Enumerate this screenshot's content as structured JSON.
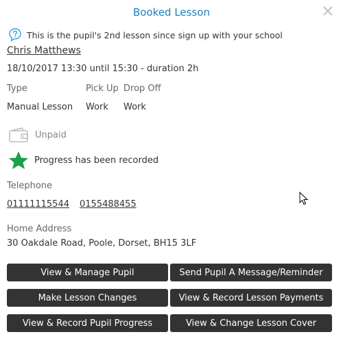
{
  "modal": {
    "title": "Booked Lesson"
  },
  "info": {
    "text": "This is the pupil's 2nd lesson since sign up with your school",
    "icon": "question-bubble-icon"
  },
  "pupil": {
    "name": "Chris Matthews"
  },
  "lesson": {
    "datetime": "18/10/2017 13:30 until 15:30 - duration 2h",
    "type_label": "Type",
    "type_value": "Manual Lesson",
    "pickup_label": "Pick Up",
    "pickup_value": "Work",
    "dropoff_label": "Drop Off",
    "dropoff_value": "Work"
  },
  "payment": {
    "status": "Unpaid",
    "icon": "wallet-icon"
  },
  "progress": {
    "text": "Progress has been recorded",
    "icon": "star-icon",
    "color": "#1aa04a"
  },
  "telephone": {
    "label": "Telephone",
    "numbers": [
      "01111115544",
      "0155488455"
    ]
  },
  "address": {
    "label": "Home Address",
    "value": "30 Oakdale Road, Poole, Dorset, BH15 3LF"
  },
  "buttons": {
    "manage_pupil": "View & Manage Pupil",
    "send_message": "Send Pupil A Message/Reminder",
    "lesson_changes": "Make Lesson Changes",
    "record_payments": "View & Record Lesson Payments",
    "record_progress": "View & Record Pupil Progress",
    "lesson_cover": "View & Change Lesson Cover"
  },
  "colors": {
    "accent": "#1f7fc2",
    "button_bg": "#333333"
  }
}
